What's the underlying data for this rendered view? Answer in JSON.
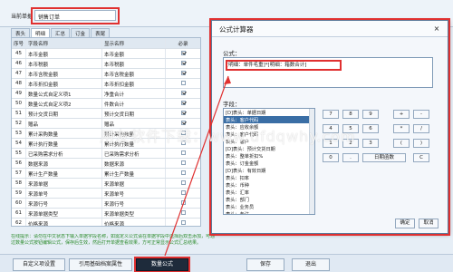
{
  "header": {
    "label": "当前单据",
    "value": "销售订单"
  },
  "tabs": [
    "表头",
    "明细",
    "汇总",
    "订金",
    "表尾"
  ],
  "grid": {
    "columns": [
      "序号",
      "字段名称",
      "显示名称",
      "必录"
    ],
    "rows": [
      {
        "no": "45",
        "name": "本币金额",
        "display": "本币金额",
        "checked": true
      },
      {
        "no": "46",
        "name": "本币税额",
        "display": "本币税额",
        "checked": true
      },
      {
        "no": "47",
        "name": "本币含税金额",
        "display": "本币含税金额",
        "checked": true
      },
      {
        "no": "48",
        "name": "本币折扣金额",
        "display": "本币折扣金额",
        "checked": false
      },
      {
        "no": "49",
        "name": "数量公式自定义项1",
        "display": "净重合计",
        "checked": true
      },
      {
        "no": "50",
        "name": "数量公式自定义项2",
        "display": "件数合计",
        "checked": true
      },
      {
        "no": "51",
        "name": "预计交货日期",
        "display": "预计交货日期",
        "checked": true
      },
      {
        "no": "52",
        "name": "赠品",
        "display": "赠品",
        "checked": true
      },
      {
        "no": "53",
        "name": "累计采购数量",
        "display": "累计采购数量",
        "checked": false
      },
      {
        "no": "54",
        "name": "累计执行数量",
        "display": "累计执行数量",
        "checked": false
      },
      {
        "no": "55",
        "name": "已采购需求分析",
        "display": "已采购需求分析",
        "checked": false
      },
      {
        "no": "56",
        "name": "数据来源",
        "display": "数据来源",
        "checked": false
      },
      {
        "no": "57",
        "name": "累计生产数量",
        "display": "累计生产数量",
        "checked": false
      },
      {
        "no": "58",
        "name": "来源单据",
        "display": "来源单据",
        "checked": false
      },
      {
        "no": "59",
        "name": "来源单号",
        "display": "来源单号",
        "checked": false
      },
      {
        "no": "60",
        "name": "来源行号",
        "display": "来源行号",
        "checked": false
      },
      {
        "no": "61",
        "name": "来源单据类型",
        "display": "来源单据类型",
        "checked": false
      },
      {
        "no": "62",
        "name": "价格来源",
        "display": "价格来源",
        "checked": false
      }
    ]
  },
  "hint": "在线提示：请勿在中文状态下输入单据字段名称，如需定义公式请在单据字段中选择后双击添加，可通过数量公式按钮编辑公式，保存后生效，然后打开单据查看效果，方可正常显示公式汇总结果。",
  "bottom_buttons": {
    "custom_items": "自定义项设置",
    "base_props": "引用基础档案属性",
    "qty_formula": "数量公式",
    "save": "保存",
    "exit": "退出"
  },
  "dialog": {
    "title": "公式计算器",
    "close": "×",
    "formula_label": "公式：",
    "formula_value": "[明细：单件毛重]*[明细：箱数合计]",
    "fields_label": "字段：",
    "fields": [
      "[D]表头：单据日期",
      "表头：客户代码",
      "表头：应收余额",
      "表头：客户代码",
      "表头：客户",
      "[D]表头：预计交货日期",
      "表头：整单折扣%",
      "表头：订金金额",
      "[D]表头：有效日期",
      "表头：扣率",
      "表头：币种",
      "表头：汇率",
      "表头：部门",
      "表头：业务员",
      "表头：备注"
    ],
    "keys": [
      "7",
      "8",
      "9",
      "+",
      "-",
      "4",
      "5",
      "6",
      "*",
      "/",
      "1",
      "2",
      "3",
      "(",
      ")",
      "0",
      ".",
      "日期函数",
      "C"
    ],
    "ok": "确定",
    "cancel": "取消"
  },
  "watermark": "用友软件下载：www.ufdqwhy.com",
  "colors": {
    "highlight": "#e03030",
    "dark_button": "#1e2b3b",
    "selected": "#3a6ea5",
    "hint": "#2a8a2a"
  }
}
